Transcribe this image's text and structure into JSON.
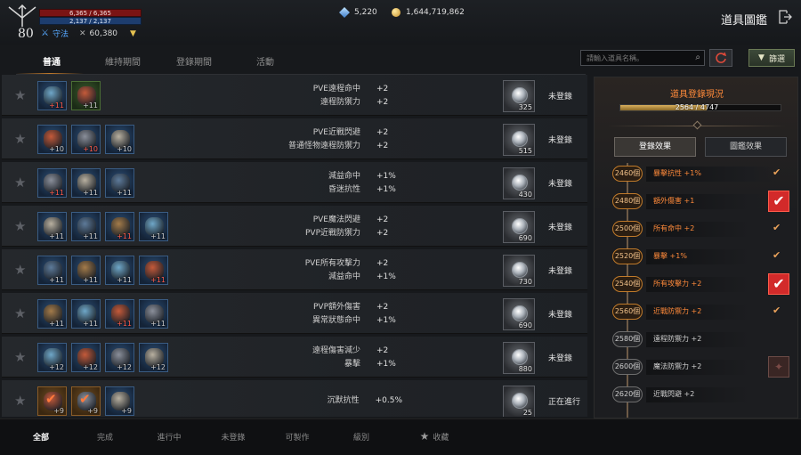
{
  "player": {
    "level": "80",
    "hp": "6,365 / 6,365",
    "mp": "2,137 / 2,137",
    "class_name": "守法",
    "combat_power": "60,380"
  },
  "currency": {
    "diamonds": "5,220",
    "gold": "1,644,719,862"
  },
  "page_title": "道具圖鑑",
  "tabs": [
    "普通",
    "維持期間",
    "登錄期間",
    "活動"
  ],
  "search": {
    "placeholder": "請輸入道具名稱。"
  },
  "filter_button": "篩選",
  "rows": [
    {
      "items": [
        {
          "enchant": "+11",
          "red": true,
          "tier": "blue"
        },
        {
          "enchant": "+11",
          "red": false,
          "tier": "green"
        }
      ],
      "stats": [
        {
          "name": "PVE遠程命中",
          "value": "+2"
        },
        {
          "name": "遠程防禦力",
          "value": "+2"
        }
      ],
      "count": "325",
      "status": "未登錄"
    },
    {
      "items": [
        {
          "enchant": "+10",
          "red": false,
          "tier": "blue"
        },
        {
          "enchant": "+10",
          "red": true,
          "tier": "blue"
        },
        {
          "enchant": "+10",
          "red": false,
          "tier": "blue"
        }
      ],
      "stats": [
        {
          "name": "PVE近戰閃避",
          "value": "+2"
        },
        {
          "name": "普通怪物遠程防禦力",
          "value": "+2"
        }
      ],
      "count": "515",
      "status": "未登錄"
    },
    {
      "items": [
        {
          "enchant": "+11",
          "red": true,
          "tier": "blue"
        },
        {
          "enchant": "+11",
          "red": false,
          "tier": "blue"
        },
        {
          "enchant": "+11",
          "red": false,
          "tier": "blue"
        }
      ],
      "stats": [
        {
          "name": "減益命中",
          "value": "+1%"
        },
        {
          "name": "昏迷抗性",
          "value": "+1%"
        }
      ],
      "count": "430",
      "status": "未登錄"
    },
    {
      "items": [
        {
          "enchant": "+11",
          "red": false,
          "tier": "blue"
        },
        {
          "enchant": "+11",
          "red": false,
          "tier": "blue"
        },
        {
          "enchant": "+11",
          "red": true,
          "tier": "blue"
        },
        {
          "enchant": "+11",
          "red": false,
          "tier": "blue"
        }
      ],
      "stats": [
        {
          "name": "PVE魔法閃避",
          "value": "+2"
        },
        {
          "name": "PVP近戰防禦力",
          "value": "+2"
        }
      ],
      "count": "690",
      "status": "未登錄"
    },
    {
      "items": [
        {
          "enchant": "+11",
          "red": false,
          "tier": "blue"
        },
        {
          "enchant": "+11",
          "red": false,
          "tier": "blue"
        },
        {
          "enchant": "+11",
          "red": false,
          "tier": "blue"
        },
        {
          "enchant": "+11",
          "red": true,
          "tier": "blue"
        }
      ],
      "stats": [
        {
          "name": "PVE所有攻擊力",
          "value": "+2"
        },
        {
          "name": "減益命中",
          "value": "+1%"
        }
      ],
      "count": "730",
      "status": "未登錄"
    },
    {
      "items": [
        {
          "enchant": "+11",
          "red": false,
          "tier": "blue"
        },
        {
          "enchant": "+11",
          "red": false,
          "tier": "blue"
        },
        {
          "enchant": "+11",
          "red": true,
          "tier": "blue"
        },
        {
          "enchant": "+11",
          "red": false,
          "tier": "blue"
        }
      ],
      "stats": [
        {
          "name": "PVP額外傷害",
          "value": "+2"
        },
        {
          "name": "異常狀態命中",
          "value": "+1%"
        }
      ],
      "count": "690",
      "status": "未登錄"
    },
    {
      "items": [
        {
          "enchant": "+12",
          "red": false,
          "tier": "blue"
        },
        {
          "enchant": "+12",
          "red": false,
          "tier": "blue"
        },
        {
          "enchant": "+12",
          "red": false,
          "tier": "blue"
        },
        {
          "enchant": "+12",
          "red": false,
          "tier": "blue"
        }
      ],
      "stats": [
        {
          "name": "遠程傷害減少",
          "value": "+2"
        },
        {
          "name": "暴擊",
          "value": "+1%"
        }
      ],
      "count": "880",
      "status": "未登錄"
    },
    {
      "items": [
        {
          "enchant": "+9",
          "red": false,
          "tier": "done",
          "checked": true
        },
        {
          "enchant": "+9",
          "red": false,
          "tier": "done",
          "checked": true
        },
        {
          "enchant": "+9",
          "red": false,
          "tier": "blue"
        }
      ],
      "stats": [
        {
          "name": "沉默抗性",
          "value": "+0.5%"
        }
      ],
      "count": "25",
      "status": "正在進行"
    }
  ],
  "panel": {
    "title": "道具登錄現況",
    "progress_text": "2564 / 4747",
    "progress_fraction": 0.54,
    "tab_effect": "登錄效果",
    "tab_codex": "圖鑑效果",
    "milestones": [
      {
        "count": "2460個",
        "text": "暴擊抗性 +1%",
        "reached": true,
        "marker": "check"
      },
      {
        "count": "2480個",
        "text": "額外傷害 +1",
        "reached": true,
        "marker": "box"
      },
      {
        "count": "2500個",
        "text": "所有命中 +2",
        "reached": true,
        "marker": "check"
      },
      {
        "count": "2520個",
        "text": "暴擊 +1%",
        "reached": true,
        "marker": "check"
      },
      {
        "count": "2540個",
        "text": "所有攻擊力 +2",
        "reached": true,
        "marker": "box"
      },
      {
        "count": "2560個",
        "text": "近戰防禦力 +2",
        "reached": true,
        "marker": "check"
      },
      {
        "count": "2580個",
        "text": "遠程防禦力 +2",
        "reached": false,
        "marker": "none"
      },
      {
        "count": "2600個",
        "text": "魔法防禦力 +2",
        "reached": false,
        "marker": "pending"
      },
      {
        "count": "2620個",
        "text": "近戰閃避 +2",
        "reached": false,
        "marker": "none"
      }
    ]
  },
  "bottom_filters": [
    "全部",
    "完成",
    "進行中",
    "未登錄",
    "可製作",
    "級別",
    "收藏"
  ],
  "colors": {
    "accent": "#ff8a3a",
    "hp": "#7a1414",
    "mp": "#1d3d6e",
    "registered_box": "#d22a2a"
  }
}
